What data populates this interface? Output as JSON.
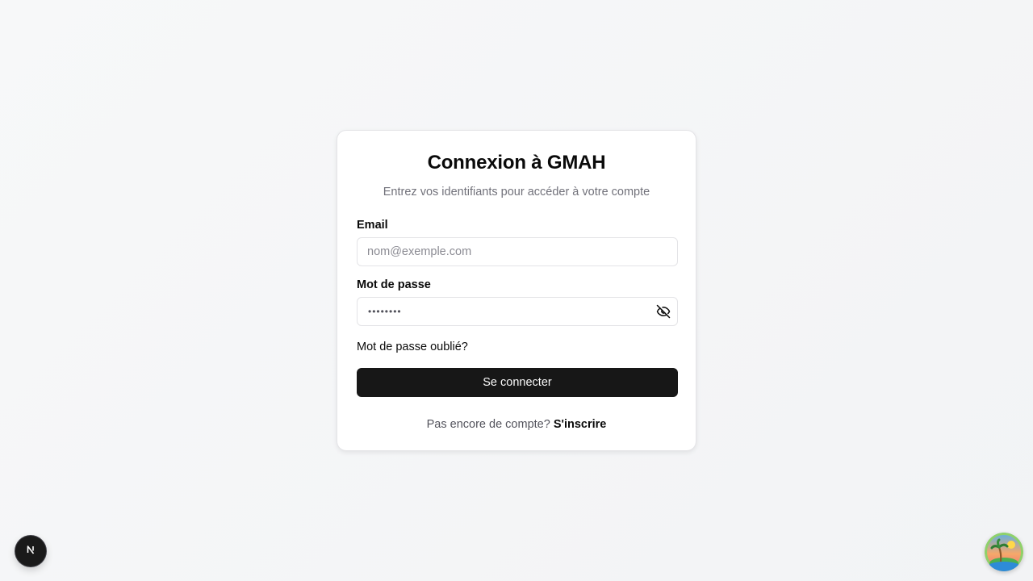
{
  "login": {
    "title": "Connexion à GMAH",
    "subtitle": "Entrez vos identifiants pour accéder à votre compte",
    "email_label": "Email",
    "email_placeholder": "nom@exemple.com",
    "email_value": "",
    "password_label": "Mot de passe",
    "password_masked": "••••••••",
    "password_toggle_icon": "eye-off-icon",
    "forgot_label": "Mot de passe oublié?",
    "submit_label": "Se connecter",
    "signup_prompt": "Pas encore de compte?",
    "signup_link": "S'inscrire"
  },
  "dev_badge": {
    "icon": "nextjs-logo-icon",
    "letter": "N"
  },
  "assistant_badge": {
    "icon": "tropical-island-icon"
  },
  "colors": {
    "primary_button": "#171717",
    "background": "#f5f6f7",
    "muted_text": "#71717a"
  }
}
